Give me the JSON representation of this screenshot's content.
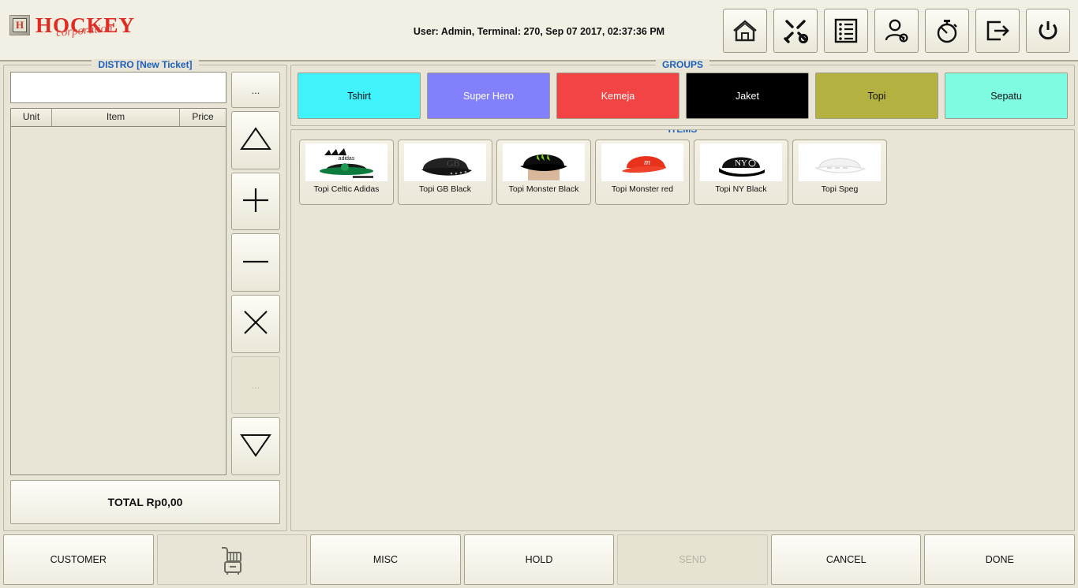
{
  "header": {
    "logo_mark": "H",
    "logo_main": "HOCKEY",
    "logo_sub": "corporation",
    "session_info": "User: Admin, Terminal: 270, Sep 07 2017, 02:37:36 PM",
    "toolbar": [
      {
        "name": "home-icon",
        "label": "Home"
      },
      {
        "name": "tools-icon",
        "label": "Tools"
      },
      {
        "name": "list-icon",
        "label": "Reports"
      },
      {
        "name": "user-settings-icon",
        "label": "User Settings"
      },
      {
        "name": "timer-icon",
        "label": "Time Clock"
      },
      {
        "name": "logout-icon",
        "label": "Log Out"
      },
      {
        "name": "power-icon",
        "label": "Shut Down"
      }
    ]
  },
  "ticket": {
    "title": "DISTRO [New Ticket]",
    "search_value": "",
    "search_placeholder": "",
    "columns": [
      "Unit",
      "Item",
      "Price"
    ],
    "rows": [],
    "total_label": "TOTAL Rp0,00",
    "side_buttons": [
      {
        "name": "more-button",
        "glyph": "...",
        "disabled": false
      },
      {
        "name": "move-up-button",
        "glyph": "triangle-up",
        "disabled": false
      },
      {
        "name": "increase-qty-button",
        "glyph": "plus",
        "disabled": false
      },
      {
        "name": "decrease-qty-button",
        "glyph": "minus",
        "disabled": false
      },
      {
        "name": "remove-item-button",
        "glyph": "cross",
        "disabled": false
      },
      {
        "name": "options-button",
        "glyph": "...",
        "disabled": true
      },
      {
        "name": "move-down-button",
        "glyph": "triangle-down",
        "disabled": false
      }
    ]
  },
  "groups": {
    "title": "GROUPS",
    "buttons": [
      {
        "label": "Tshirt",
        "bg": "#40f2fc",
        "fg": "#111111"
      },
      {
        "label": "Super Hero",
        "bg": "#8280fb",
        "fg": "#ffffff"
      },
      {
        "label": "Kemeja",
        "bg": "#f24444",
        "fg": "#ffffff"
      },
      {
        "label": "Jaket",
        "bg": "#000000",
        "fg": "#ffffff"
      },
      {
        "label": "Topi",
        "bg": "#b3b140",
        "fg": "#111111"
      },
      {
        "label": "Sepatu",
        "bg": "#7ffbe2",
        "fg": "#111111"
      }
    ]
  },
  "items": {
    "title": "ITEMS",
    "cards": [
      {
        "label": "Topi Celtic Adidas",
        "thumb": "cap-celtic-adidas"
      },
      {
        "label": "Topi GB Black",
        "thumb": "cap-gb-black"
      },
      {
        "label": "Topi Monster Black",
        "thumb": "cap-monster-black"
      },
      {
        "label": "Topi Monster red",
        "thumb": "cap-monster-red"
      },
      {
        "label": "Topi NY Black",
        "thumb": "cap-ny-black"
      },
      {
        "label": "Topi Speg",
        "thumb": "cap-speg-white"
      }
    ]
  },
  "footer": {
    "buttons": [
      {
        "name": "customer-button",
        "label": "CUSTOMER",
        "disabled": false,
        "icon": ""
      },
      {
        "name": "cart-button",
        "label": "",
        "disabled": true,
        "icon": "cart-icon"
      },
      {
        "name": "misc-button",
        "label": "MISC",
        "disabled": false,
        "icon": ""
      },
      {
        "name": "hold-button",
        "label": "HOLD",
        "disabled": false,
        "icon": ""
      },
      {
        "name": "send-button",
        "label": "SEND",
        "disabled": true,
        "icon": ""
      },
      {
        "name": "cancel-button",
        "label": "CANCEL",
        "disabled": false,
        "icon": ""
      },
      {
        "name": "done-button",
        "label": "DONE",
        "disabled": false,
        "icon": ""
      }
    ]
  },
  "colors": {
    "background": "#e8e5d6",
    "panel_border": "#b8b5a2",
    "title_blue": "#1d5fbf",
    "brand_red": "#e02b20"
  }
}
